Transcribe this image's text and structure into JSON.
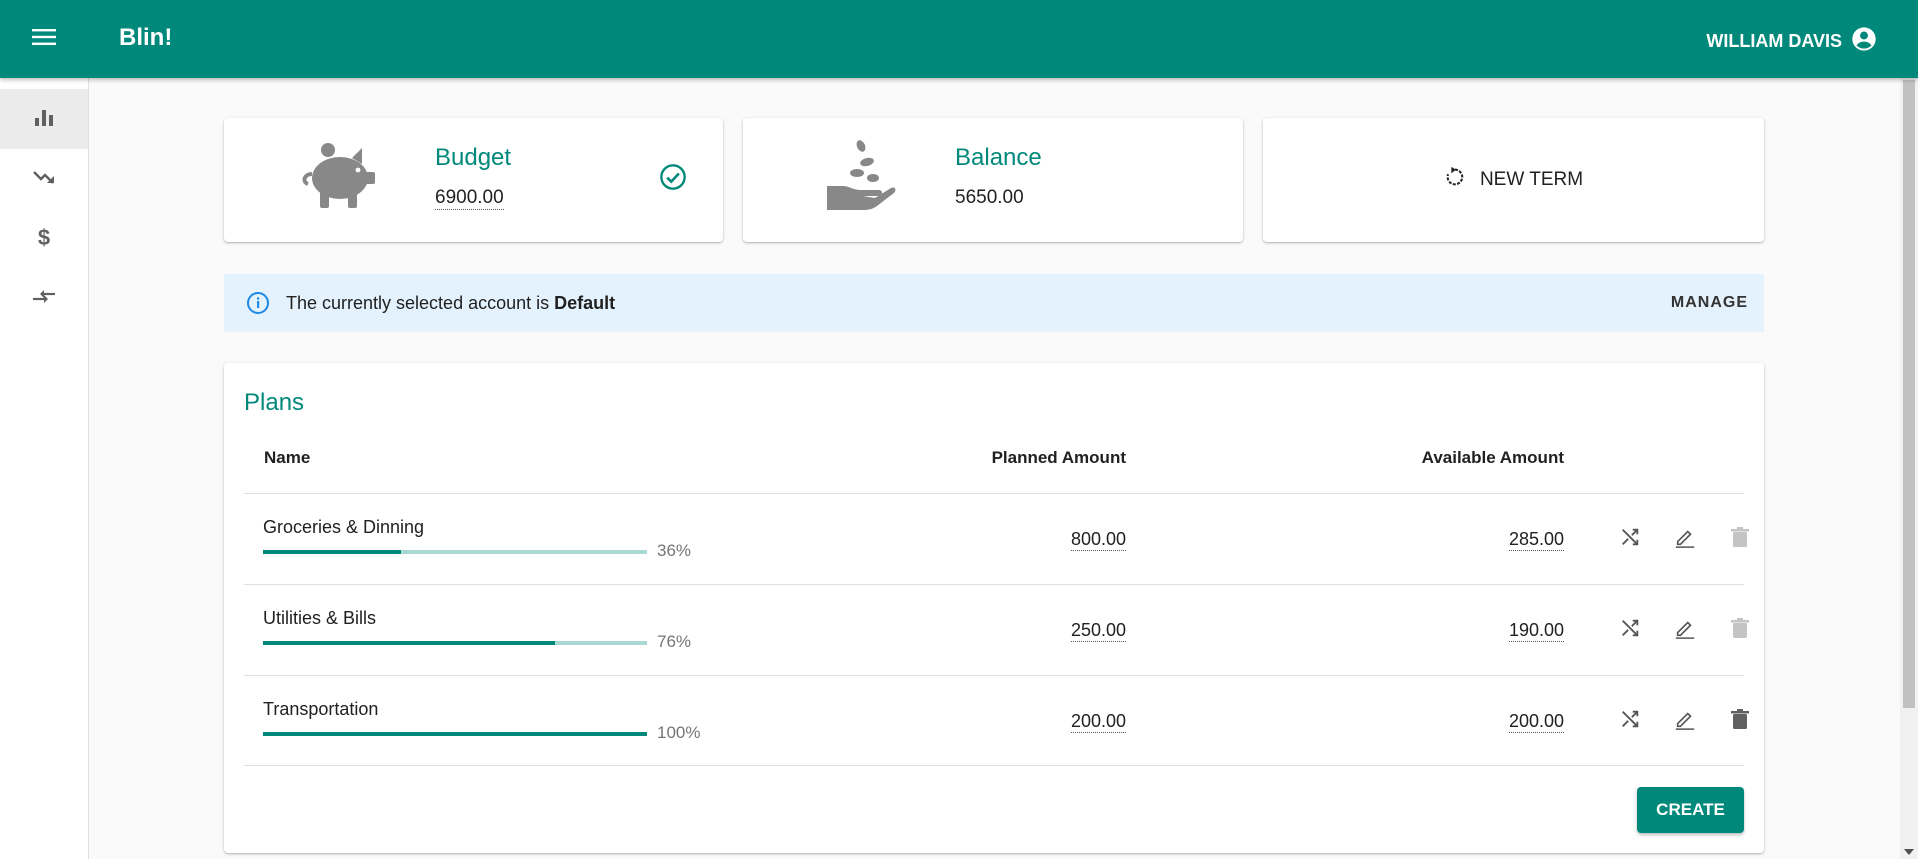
{
  "app": {
    "title": "Blin!",
    "user_name": "WILLIAM DAVIS"
  },
  "sidebar": {
    "items": [
      {
        "icon": "bar-chart-icon",
        "active": true
      },
      {
        "icon": "trending-down-icon",
        "active": false
      },
      {
        "icon": "dollar-icon",
        "active": false
      },
      {
        "icon": "compare-arrows-icon",
        "active": false
      }
    ]
  },
  "summary": {
    "budget": {
      "title": "Budget",
      "value": "6900.00",
      "icon": "piggy-bank-icon",
      "status_icon": "check-circle-icon"
    },
    "balance": {
      "title": "Balance",
      "value": "5650.00",
      "icon": "hand-coins-icon"
    },
    "new_term": {
      "label": "NEW TERM",
      "icon": "restart-icon"
    }
  },
  "alert": {
    "text_prefix": "The currently selected account is",
    "account": "Default",
    "action_label": "MANAGE",
    "icon": "info-icon"
  },
  "plans": {
    "title": "Plans",
    "columns": {
      "name": "Name",
      "planned": "Planned Amount",
      "available": "Available Amount"
    },
    "rows": [
      {
        "name": "Groceries & Dinning",
        "progress": 0.36,
        "progress_label": "36%",
        "planned": "800.00",
        "available": "285.00",
        "delete_enabled": false
      },
      {
        "name": "Utilities & Bills",
        "progress": 0.76,
        "progress_label": "76%",
        "planned": "250.00",
        "available": "190.00",
        "delete_enabled": false
      },
      {
        "name": "Transportation",
        "progress": 1.0,
        "progress_label": "100%",
        "planned": "200.00",
        "available": "200.00",
        "delete_enabled": true
      }
    ],
    "create_label": "CREATE"
  },
  "colors": {
    "primary": "#00897b",
    "primary_light": "#a7d8d2",
    "alert_bg": "#e3f2fd",
    "info": "#1e88e5"
  }
}
